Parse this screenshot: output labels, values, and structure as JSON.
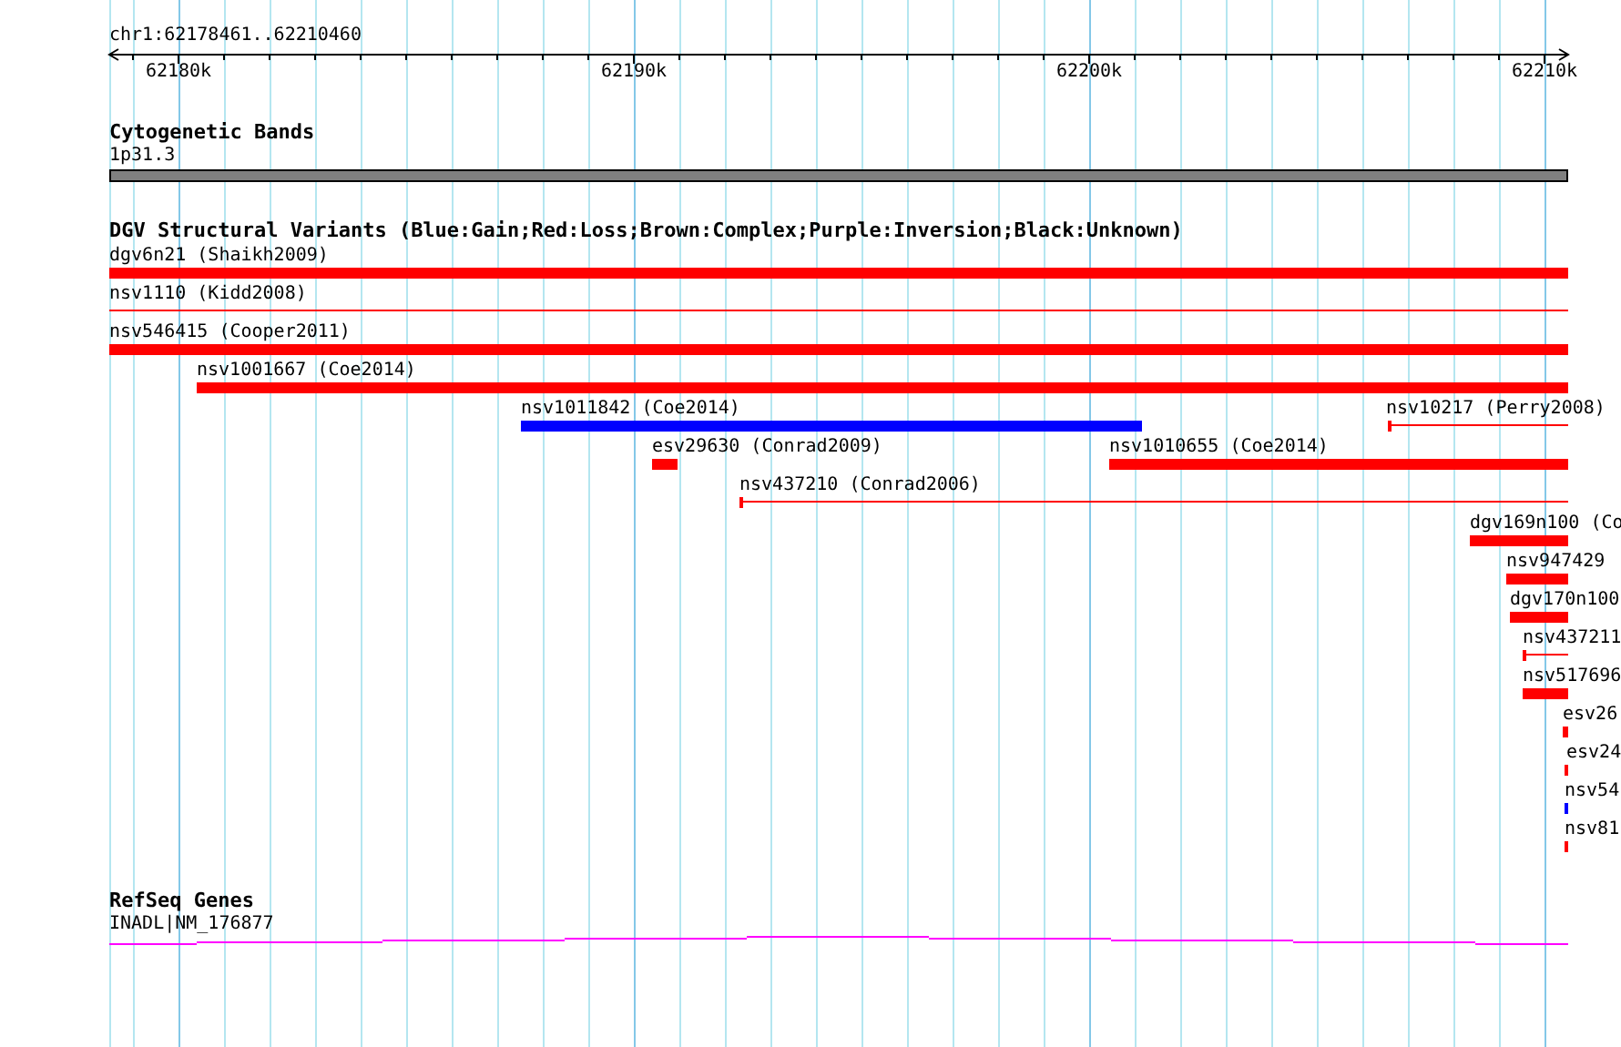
{
  "ruler": {
    "range": "chr1:62178461..62210460",
    "ticks": [
      "62180k",
      "62190k",
      "62200k",
      "62210k"
    ]
  },
  "cytogenetic_bands": {
    "title": "Cytogenetic Bands",
    "band": "1p31.3"
  },
  "dgv_variants": {
    "title": "DGV Structural Variants (Blue:Gain;Red:Loss;Brown:Complex;Purple:Inversion;Black:Unknown)",
    "features": [
      {
        "label": "dgv6n21 (Shaikh2009)",
        "kind": "bar",
        "color": "#ff0000"
      },
      {
        "label": "nsv1110 (Kidd2008)",
        "kind": "line",
        "color": "#ff0000"
      },
      {
        "label": "nsv546415 (Cooper2011)",
        "kind": "bar",
        "color": "#ff0000"
      },
      {
        "label": "nsv1001667 (Coe2014)",
        "kind": "bar",
        "color": "#ff0000"
      },
      {
        "label": "nsv1011842 (Coe2014)",
        "kind": "bar",
        "color": "#0000ff"
      },
      {
        "label": "nsv10217 (Perry2008)",
        "kind": "line",
        "color": "#ff0000"
      },
      {
        "label": "esv29630 (Conrad2009)",
        "kind": "bar",
        "color": "#ff0000"
      },
      {
        "label": "nsv1010655 (Coe2014)",
        "kind": "bar",
        "color": "#ff0000"
      },
      {
        "label": "nsv437210 (Conrad2006)",
        "kind": "line",
        "color": "#ff0000"
      },
      {
        "label": "dgv169n100 (Co",
        "kind": "bar",
        "color": "#ff0000"
      },
      {
        "label": "nsv947429",
        "kind": "bar",
        "color": "#ff0000"
      },
      {
        "label": "dgv170n100",
        "kind": "bar",
        "color": "#ff0000"
      },
      {
        "label": "nsv437211",
        "kind": "line",
        "color": "#ff0000"
      },
      {
        "label": "nsv517696",
        "kind": "bar",
        "color": "#ff0000"
      },
      {
        "label": "esv26",
        "kind": "bar",
        "color": "#ff0000"
      },
      {
        "label": "esv24",
        "kind": "bar",
        "color": "#ff0000"
      },
      {
        "label": "nsv54",
        "kind": "bar",
        "color": "#0000ff"
      },
      {
        "label": "nsv81",
        "kind": "bar",
        "color": "#ff0000"
      }
    ]
  },
  "refseq_genes": {
    "title": "RefSeq Genes",
    "gene": "INADL|NM_176877"
  }
}
